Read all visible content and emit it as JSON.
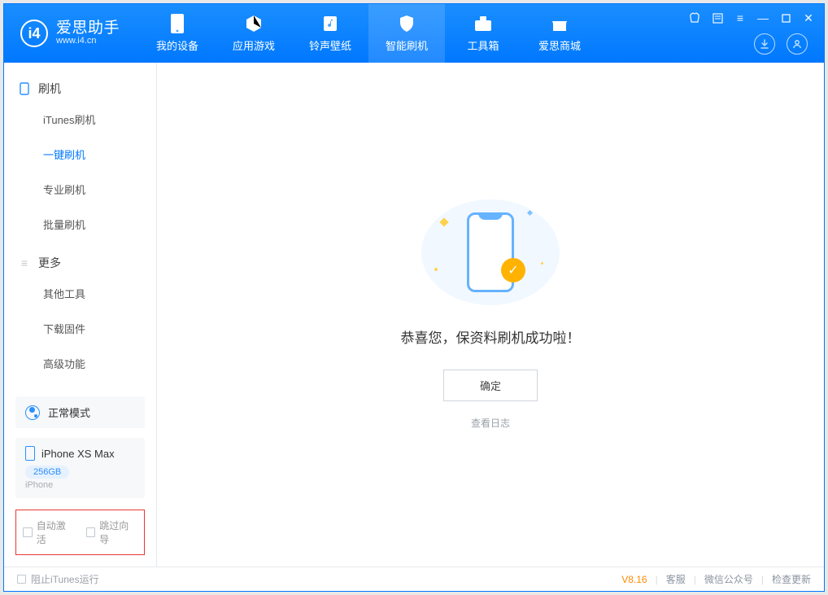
{
  "app": {
    "title": "爱思助手",
    "site": "www.i4.cn"
  },
  "nav": {
    "items": [
      {
        "label": "我的设备"
      },
      {
        "label": "应用游戏"
      },
      {
        "label": "铃声壁纸"
      },
      {
        "label": "智能刷机"
      },
      {
        "label": "工具箱"
      },
      {
        "label": "爱思商城"
      }
    ]
  },
  "window_icons": {
    "tshirt": "⌂",
    "book": "▢",
    "menu": "≡",
    "min": "—",
    "max": "❐",
    "close": "✕"
  },
  "sidebar": {
    "group1": {
      "title": "刷机",
      "items": [
        {
          "label": "iTunes刷机"
        },
        {
          "label": "一键刷机"
        },
        {
          "label": "专业刷机"
        },
        {
          "label": "批量刷机"
        }
      ]
    },
    "group2": {
      "title": "更多",
      "items": [
        {
          "label": "其他工具"
        },
        {
          "label": "下载固件"
        },
        {
          "label": "高级功能"
        }
      ]
    },
    "mode_label": "正常模式",
    "device": {
      "name": "iPhone XS Max",
      "capacity": "256GB",
      "type": "iPhone"
    },
    "checks": {
      "c1": "自动激活",
      "c2": "跳过向导"
    }
  },
  "main": {
    "message": "恭喜您，保资料刷机成功啦！",
    "ok": "确定",
    "log": "查看日志"
  },
  "status": {
    "block_itunes": "阻止iTunes运行",
    "version": "V8.16",
    "links": [
      "客服",
      "微信公众号",
      "检查更新"
    ]
  }
}
